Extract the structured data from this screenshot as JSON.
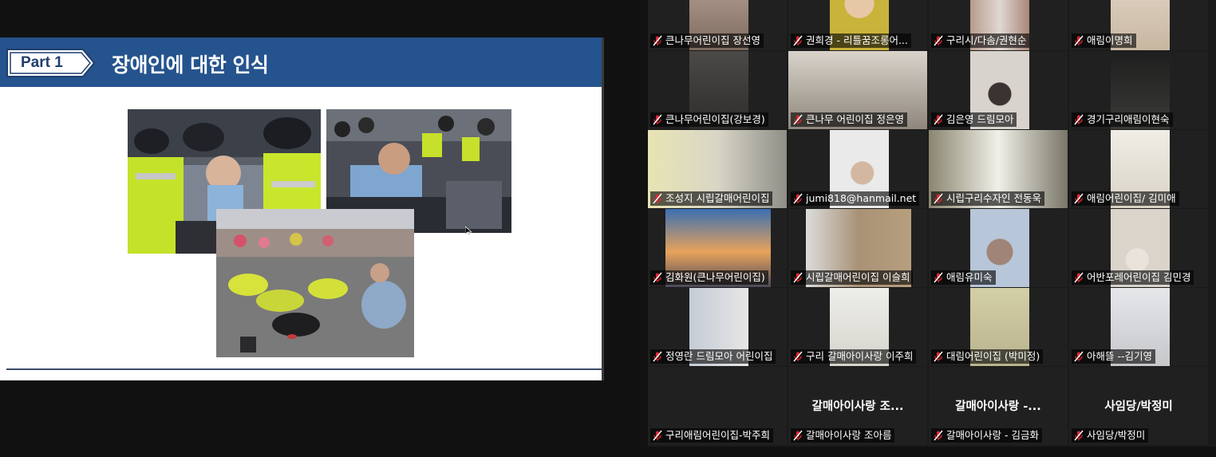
{
  "slide": {
    "part_label": "Part 1",
    "title": "장애인에 대한 인식",
    "photos": [
      "protest-photo-police",
      "protest-photo-crowd",
      "protest-photo-street-crawl"
    ]
  },
  "participants": [
    {
      "name": "큰나무어린이집 장선영",
      "video": "warm"
    },
    {
      "name": "권희경 - 리틀꿈조롱어...",
      "video": "yellow-face"
    },
    {
      "name": "구리시/다솜/권현순",
      "video": "room-light"
    },
    {
      "name": "애림이명희",
      "video": "beige"
    },
    {
      "name": "큰나무어린이집(강보경)",
      "video": "dark-grey"
    },
    {
      "name": "큰나무 어린이집 정은영",
      "video": "ceiling"
    },
    {
      "name": "김은영 드림모아",
      "video": "person-wall"
    },
    {
      "name": "경기구리애림이현숙",
      "video": "dark-lamp"
    },
    {
      "name": "조성지 시립갈매어린이집",
      "video": "bright-window"
    },
    {
      "name": "jumi818@hanmail.net",
      "video": "person-fan"
    },
    {
      "name": "시립구리수자인 전동욱",
      "video": "blur-window"
    },
    {
      "name": "애림어린이집/ 김미애",
      "video": "pale"
    },
    {
      "name": "김화원(큰나무어린이집)",
      "video": "paris-tower"
    },
    {
      "name": "시립갈매어린이집 이슬희",
      "video": "tan"
    },
    {
      "name": "애림유미숙",
      "video": "person-trees"
    },
    {
      "name": "어반포레어린이집 김민경",
      "video": "person-frame"
    },
    {
      "name": "정영란 드림모아 어린이집",
      "video": "wall-blue"
    },
    {
      "name": "구리 갈매아이사랑 이주희",
      "video": "paper"
    },
    {
      "name": "대림어린이집 (박미정)",
      "video": "green-board"
    },
    {
      "name": "아해뜰 --김기영",
      "video": "window-pale"
    },
    {
      "name": "구리애림어린이집-박주희",
      "video": "none",
      "big": ""
    },
    {
      "name": "갈매아이사랑 조아름",
      "video": "none",
      "big": "갈매아이사랑 조..."
    },
    {
      "name": "갈매아이사랑 - 김금화",
      "video": "none",
      "big": "갈매아이사랑 -..."
    },
    {
      "name": "사임당/박정미",
      "video": "none",
      "big": "사임당/박정미"
    }
  ],
  "colors": {
    "slide_header": "#25538d",
    "mute_red": "#e0262f",
    "background": "#111111"
  }
}
